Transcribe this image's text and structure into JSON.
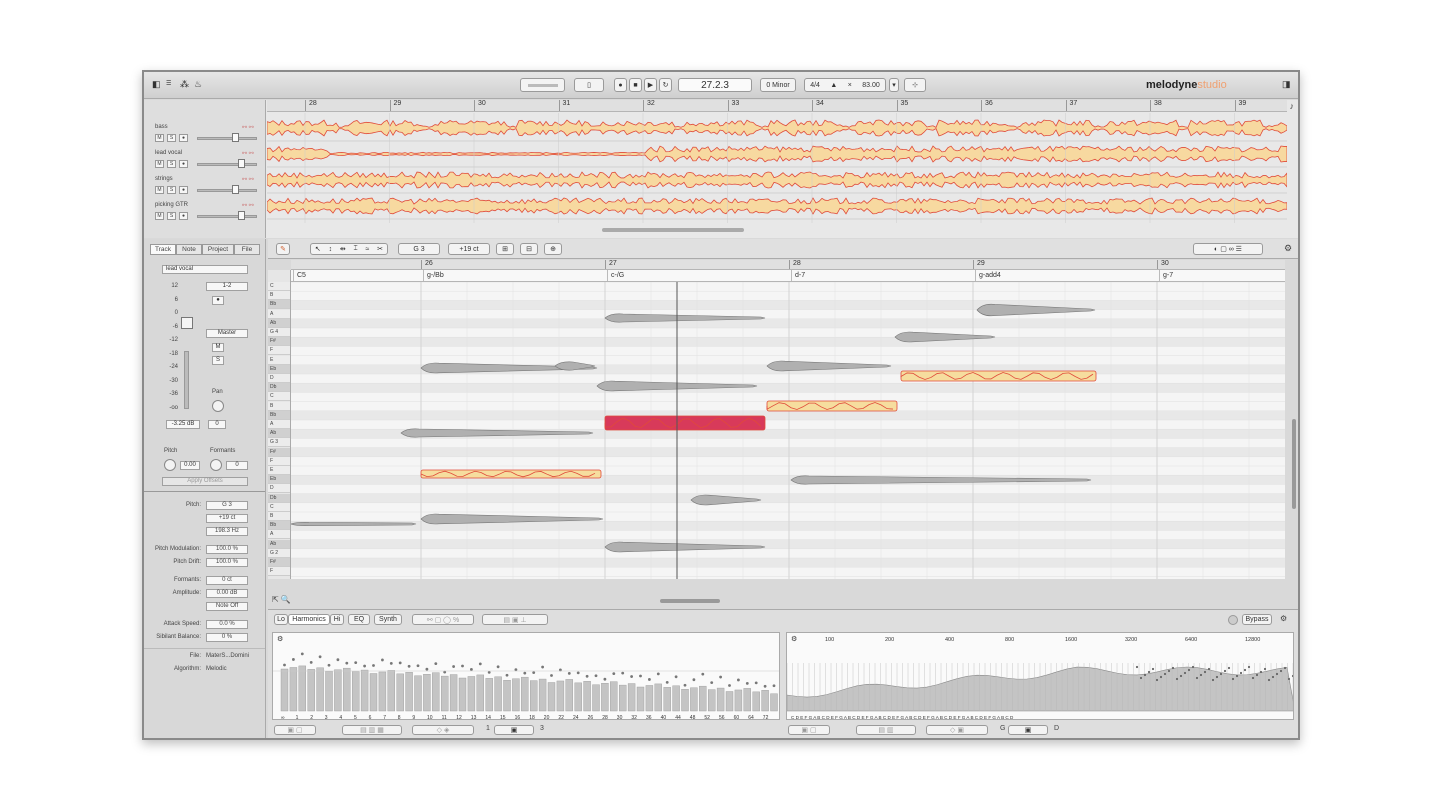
{
  "app": {
    "logo": "melodyne",
    "logo_edition": "studio"
  },
  "transport": {
    "position": "27.2.3",
    "key": "0 Minor",
    "meter": "4/4",
    "tempo": "83.00",
    "tempo_mult": "×"
  },
  "overview": {
    "bars": [
      "28",
      "29",
      "30",
      "31",
      "32",
      "33",
      "34",
      "35",
      "36",
      "37",
      "38",
      "39"
    ],
    "tracks": [
      {
        "name": "bass"
      },
      {
        "name": "lead vocal"
      },
      {
        "name": "strings"
      },
      {
        "name": "picking GTR"
      }
    ],
    "mute": "M",
    "solo": "S"
  },
  "inspector": {
    "tabs": [
      "Track",
      "Note",
      "Project",
      "File"
    ],
    "track_name": "lead vocal",
    "db_scale": [
      "12",
      "6",
      "0",
      "-6",
      "-12",
      "-18",
      "-24",
      "-30",
      "-36",
      "-oo"
    ],
    "input": "1-2",
    "output": "Master",
    "mute": "M",
    "solo": "S",
    "pan_label": "Pan",
    "volume": "-3.25 dB",
    "pan": "0",
    "pitch_label": "Pitch",
    "formants_label": "Formants",
    "pitch_value": "0.00",
    "formants_value": "0",
    "apply_offsets": "Apply Offsets",
    "note_params": [
      {
        "label": "Pitch:",
        "value": "G 3"
      },
      {
        "label": "",
        "value": "+19 ct"
      },
      {
        "label": "",
        "value": "198.3 Hz"
      },
      {
        "label": "Pitch Modulation:",
        "value": "100.0 %"
      },
      {
        "label": "Pitch Drift:",
        "value": "100.0 %"
      },
      {
        "label": "Formants:",
        "value": "0 ct"
      },
      {
        "label": "Amplitude:",
        "value": "0.00 dB"
      },
      {
        "label": "",
        "value": "Note Off"
      },
      {
        "label": "Attack Speed:",
        "value": "0.0 %"
      },
      {
        "label": "Sibilant Balance:",
        "value": "0 %"
      }
    ],
    "file_label": "File:",
    "file_value": "MaterS...Domini",
    "algorithm_label": "Algorithm:",
    "algorithm_value": "Melodic"
  },
  "editor": {
    "pitch_field": "G 3",
    "cents_field": "+19 ct",
    "bars": [
      "26",
      "27",
      "28",
      "29",
      "30"
    ],
    "chords": [
      "C5",
      "g-/Bb",
      "c-/G",
      "d-7",
      "g-add4",
      "g-7"
    ],
    "keys": [
      "C",
      "B",
      "Bb",
      "A",
      "Ab",
      "G 4",
      "F#",
      "F",
      "E",
      "Eb",
      "D",
      "Db",
      "C",
      "B",
      "Bb",
      "A",
      "Ab",
      "G 3",
      "F#",
      "F",
      "E",
      "Eb",
      "D",
      "Db",
      "C",
      "B",
      "Bb",
      "A",
      "Ab",
      "G 2",
      "F#",
      "F"
    ]
  },
  "sound_editor": {
    "tabs": [
      "Lo",
      "Harmonics",
      "Hi",
      "EQ",
      "Synth"
    ],
    "bypass": "Bypass",
    "harm_numbers": [
      "∞",
      "1",
      "2",
      "3",
      "4",
      "5",
      "6",
      "7",
      "8",
      "9",
      "10",
      "11",
      "12",
      "13",
      "14",
      "15",
      "16",
      "18",
      "20",
      "22",
      "24",
      "26",
      "28",
      "30",
      "32",
      "36",
      "40",
      "44",
      "48",
      "52",
      "56",
      "60",
      "64",
      "72"
    ],
    "freq_labels": [
      "100",
      "200",
      "400",
      "800",
      "1600",
      "3200",
      "6400",
      "12800"
    ],
    "note_row": "C D E F G A B C D E F G A B C D E F G A B C D E F G A B C D E F G A B C D E F G A B C D E F G A B C D",
    "bottom_values": [
      "1",
      "3",
      "G",
      "D"
    ]
  }
}
